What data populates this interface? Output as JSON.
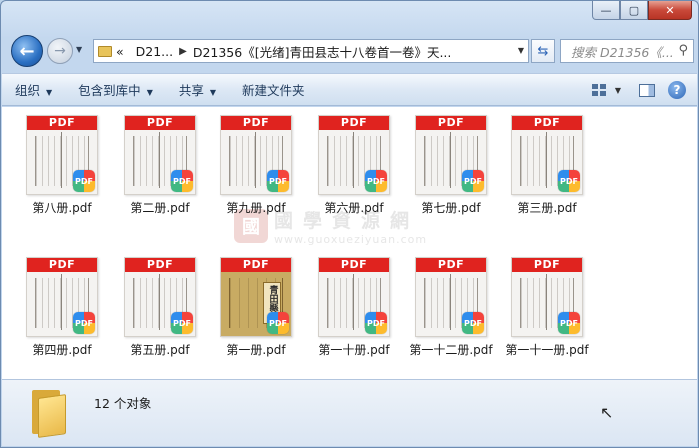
{
  "window": {
    "minimize_label": "—",
    "maximize_label": "▢",
    "close_label": "✕"
  },
  "nav": {
    "back_glyph": "←",
    "forward_glyph": "→"
  },
  "address": {
    "prefix": "«",
    "crumb1": "D21...",
    "crumb2": "D21356《[光绪]青田县志十八卷首一卷》天..."
  },
  "search": {
    "placeholder": "搜索 D21356《..."
  },
  "toolbar": {
    "organize": "组织",
    "include_library": "包含到库中",
    "share": "共享",
    "new_folder": "新建文件夹"
  },
  "files": [
    {
      "name": "第八册.pdf",
      "badge": "PDF"
    },
    {
      "name": "第二册.pdf",
      "badge": "PDF"
    },
    {
      "name": "第九册.pdf",
      "badge": "PDF"
    },
    {
      "name": "第六册.pdf",
      "badge": "PDF"
    },
    {
      "name": "第七册.pdf",
      "badge": "PDF"
    },
    {
      "name": "第三册.pdf",
      "badge": "PDF"
    },
    {
      "name": "第四册.pdf",
      "badge": "PDF"
    },
    {
      "name": "第五册.pdf",
      "badge": "PDF"
    },
    {
      "name": "第一册.pdf",
      "badge": "PDF",
      "cover_text": "青田縣志"
    },
    {
      "name": "第一十册.pdf",
      "badge": "PDF"
    },
    {
      "name": "第一十二册.pdf",
      "badge": "PDF"
    },
    {
      "name": "第一十一册.pdf",
      "badge": "PDF"
    }
  ],
  "watermark": {
    "seal": "國",
    "text": "國學資源網",
    "url": "www.guoxueziyuan.com"
  },
  "status": {
    "count_text": "12 个对象"
  }
}
